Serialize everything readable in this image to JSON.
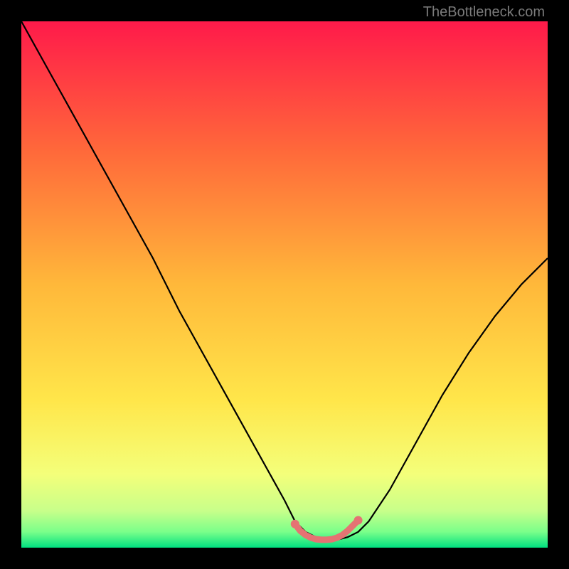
{
  "watermark": "TheBottleneck.com",
  "chart_data": {
    "type": "line",
    "title": "",
    "xlabel": "",
    "ylabel": "",
    "xlim": [
      0,
      100
    ],
    "ylim": [
      0,
      100
    ],
    "series": [
      {
        "name": "bottleneck-curve",
        "color": "#000000",
        "x": [
          0,
          5,
          10,
          15,
          20,
          25,
          30,
          35,
          40,
          45,
          50,
          52,
          54,
          56,
          58,
          60,
          62,
          64,
          66,
          70,
          75,
          80,
          85,
          90,
          95,
          100
        ],
        "y": [
          100,
          91,
          82,
          73,
          64,
          55,
          45,
          36,
          27,
          18,
          9,
          5,
          3,
          2,
          1.5,
          1.5,
          2,
          3,
          5,
          11,
          20,
          29,
          37,
          44,
          50,
          55
        ]
      },
      {
        "name": "optimal-marker",
        "color": "#e57373",
        "type": "scatter",
        "x": [
          52,
          53,
          54,
          55,
          56,
          57,
          58,
          59,
          60,
          61,
          62,
          63,
          64
        ],
        "y": [
          4.5,
          3.2,
          2.4,
          1.9,
          1.6,
          1.5,
          1.5,
          1.6,
          1.9,
          2.4,
          3.2,
          4.2,
          5.2
        ]
      }
    ],
    "background_gradient": {
      "stops": [
        {
          "offset": 0.0,
          "color": "#ff1a4a"
        },
        {
          "offset": 0.25,
          "color": "#ff6a3a"
        },
        {
          "offset": 0.5,
          "color": "#ffb83a"
        },
        {
          "offset": 0.72,
          "color": "#ffe64a"
        },
        {
          "offset": 0.86,
          "color": "#f4ff7a"
        },
        {
          "offset": 0.93,
          "color": "#c8ff8a"
        },
        {
          "offset": 0.97,
          "color": "#7aff8a"
        },
        {
          "offset": 1.0,
          "color": "#00e080"
        }
      ]
    }
  }
}
